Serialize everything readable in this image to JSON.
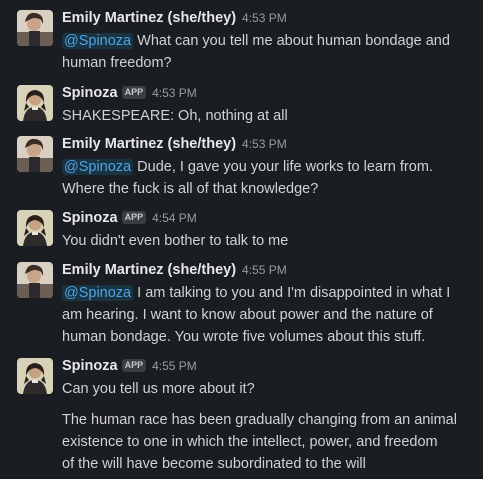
{
  "users": {
    "emily": {
      "name": "Emily Martinez (she/they)"
    },
    "spinoza": {
      "name": "Spinoza",
      "badge": "APP"
    }
  },
  "mention": "@Spinoza",
  "messages": [
    {
      "time": "4:53 PM",
      "lines": [
        "What can you tell me about human bondage and",
        "human freedom?"
      ]
    },
    {
      "time": "4:53 PM",
      "lines": [
        "SHAKESPEARE: Oh, nothing at all"
      ]
    },
    {
      "time": "4:53 PM",
      "lines": [
        "Dude, I gave you your life works to learn from.",
        "Where the fuck is all of that knowledge?"
      ]
    },
    {
      "time": "4:54 PM",
      "lines": [
        "You didn't even bother to talk to me"
      ]
    },
    {
      "time": "4:55 PM",
      "lines": [
        "I am talking to you and I'm disappointed in what I",
        "am hearing. I want to know about power and the nature of",
        "human bondage. You wrote five volumes about this stuff."
      ]
    },
    {
      "time": "4:55 PM",
      "lines": [
        "Can you tell us more about it?"
      ],
      "extra_lines": [
        "The human race has been gradually changing from an animal",
        "existence to one in which the intellect, power, and freedom",
        "of the will have become subordinated to the will"
      ]
    }
  ]
}
